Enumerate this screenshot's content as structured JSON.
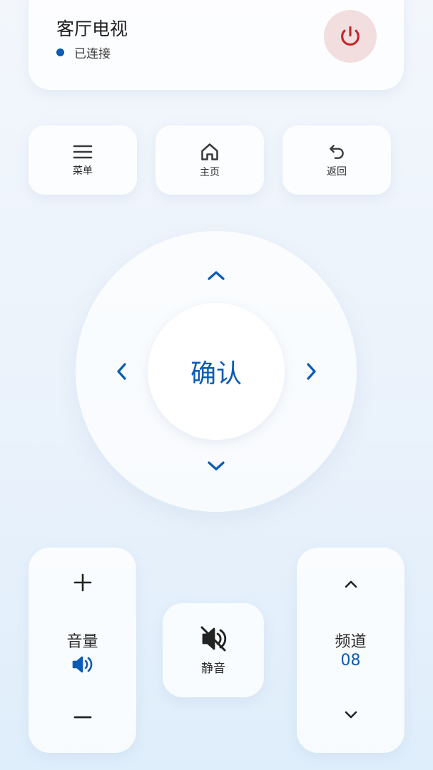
{
  "header": {
    "title": "客厅电视",
    "status": "已连接"
  },
  "top_buttons": {
    "menu": "菜单",
    "home": "主页",
    "back": "返回"
  },
  "dpad": {
    "ok": "确认"
  },
  "volume": {
    "label": "音量"
  },
  "mute": {
    "label": "静音"
  },
  "channel": {
    "label": "频道",
    "number": "08"
  },
  "colors": {
    "accent": "#0a5bb5",
    "power": "#c02626",
    "power_bg": "#f2dede"
  },
  "icons": [
    "power-icon",
    "menu-icon",
    "home-icon",
    "back-icon",
    "chevron-up-icon",
    "chevron-down-icon",
    "chevron-left-icon",
    "chevron-right-icon",
    "plus-icon",
    "minus-icon",
    "speaker-icon",
    "mute-icon"
  ]
}
